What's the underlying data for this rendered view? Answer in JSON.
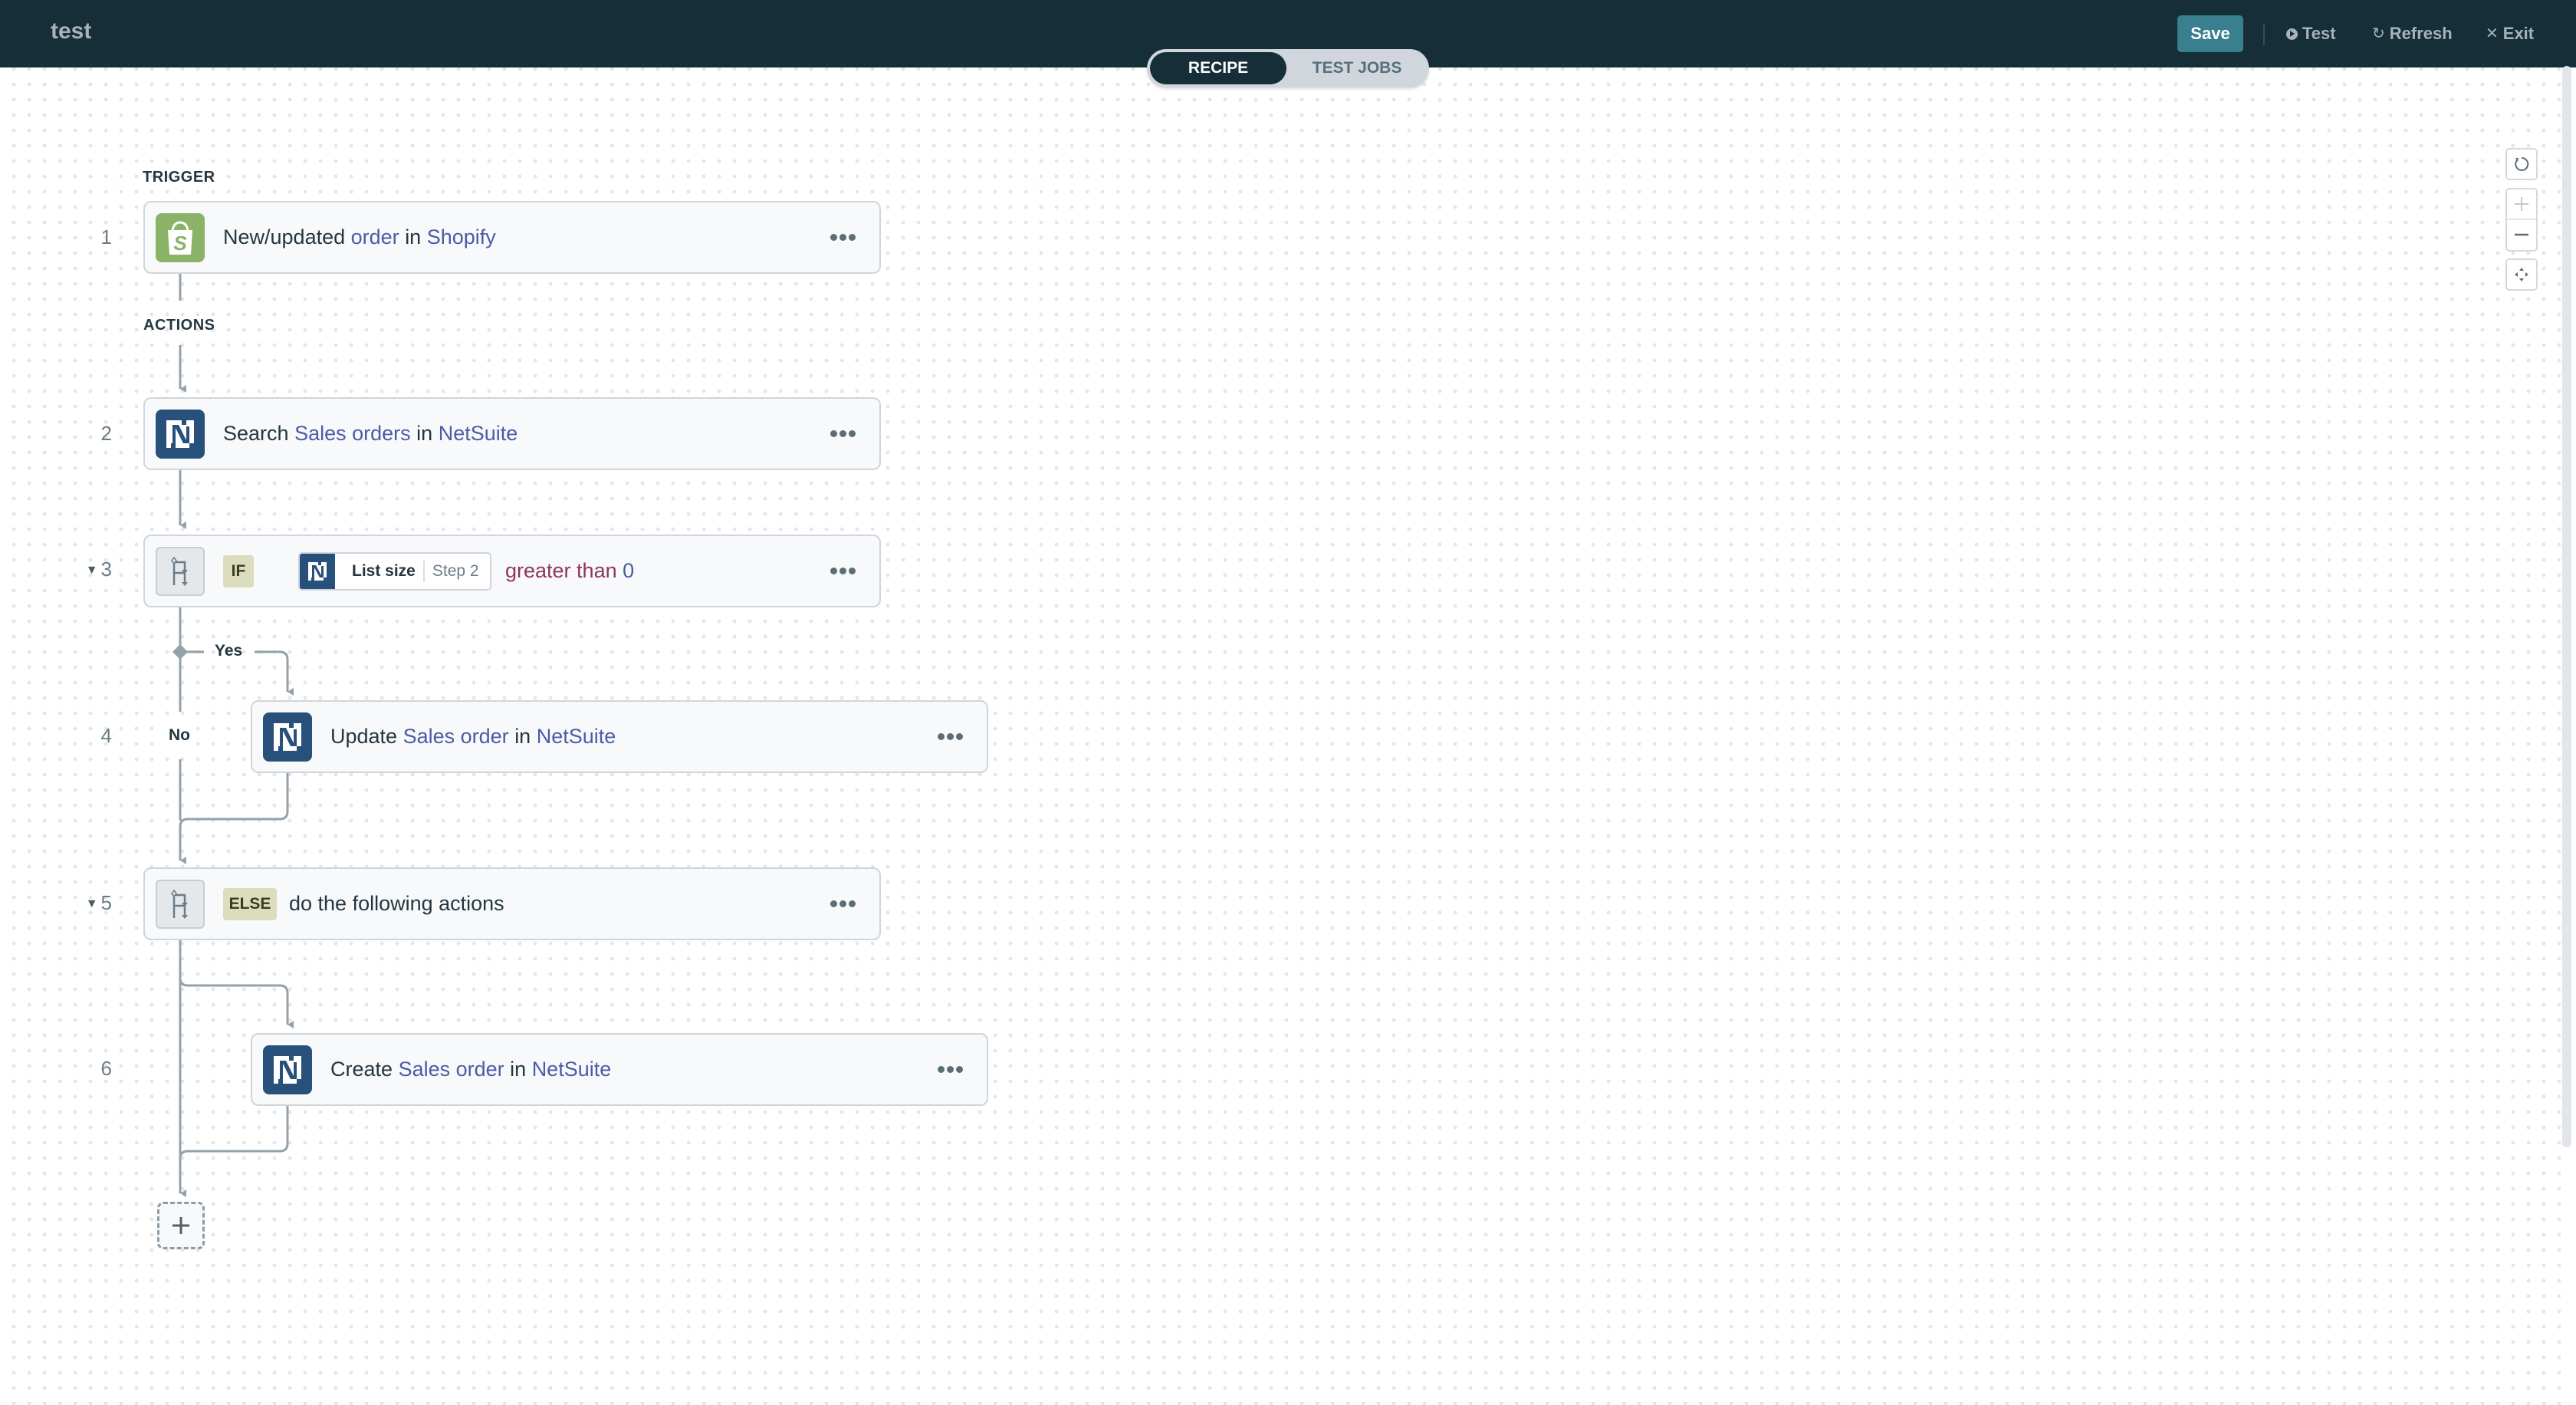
{
  "header": {
    "title": "test",
    "save_label": "Save",
    "test_label": "Test",
    "refresh_label": "Refresh",
    "exit_label": "Exit"
  },
  "tabs": [
    {
      "label": "RECIPE",
      "active": true
    },
    {
      "label": "TEST JOBS",
      "active": false
    }
  ],
  "sections": {
    "trigger": "TRIGGER",
    "actions": "ACTIONS"
  },
  "steps": [
    {
      "number": "1",
      "app": "Shopify",
      "icon": "shopify-icon",
      "verb": "New/updated",
      "object": "order",
      "connector": "in",
      "app_name": "Shopify"
    },
    {
      "number": "2",
      "app": "NetSuite",
      "icon": "netsuite-icon",
      "verb": "Search",
      "object": "Sales orders",
      "connector": "in",
      "app_name": "NetSuite"
    },
    {
      "number": "3",
      "keyword": "IF",
      "field": "List size",
      "field_source": "Step 2",
      "operator": "greater than",
      "value": "0",
      "collapsible": true
    },
    {
      "number": "4",
      "app": "NetSuite",
      "icon": "netsuite-icon",
      "verb": "Update",
      "object": "Sales order",
      "connector": "in",
      "app_name": "NetSuite"
    },
    {
      "number": "5",
      "keyword": "ELSE",
      "text": "do the following actions",
      "collapsible": true
    },
    {
      "number": "6",
      "app": "NetSuite",
      "icon": "netsuite-icon",
      "verb": "Create",
      "object": "Sales order",
      "connector": "in",
      "app_name": "NetSuite"
    }
  ],
  "branch_labels": {
    "yes": "Yes",
    "no": "No"
  },
  "colors": {
    "header_bg": "#152e37",
    "save_button": "#3a7f8e",
    "highlight_text": "#4b5ba7",
    "operator_text": "#8e3560",
    "shopify": "#8ab367",
    "netsuite": "#27507a",
    "keyword_bg": "#dcdcbf"
  }
}
